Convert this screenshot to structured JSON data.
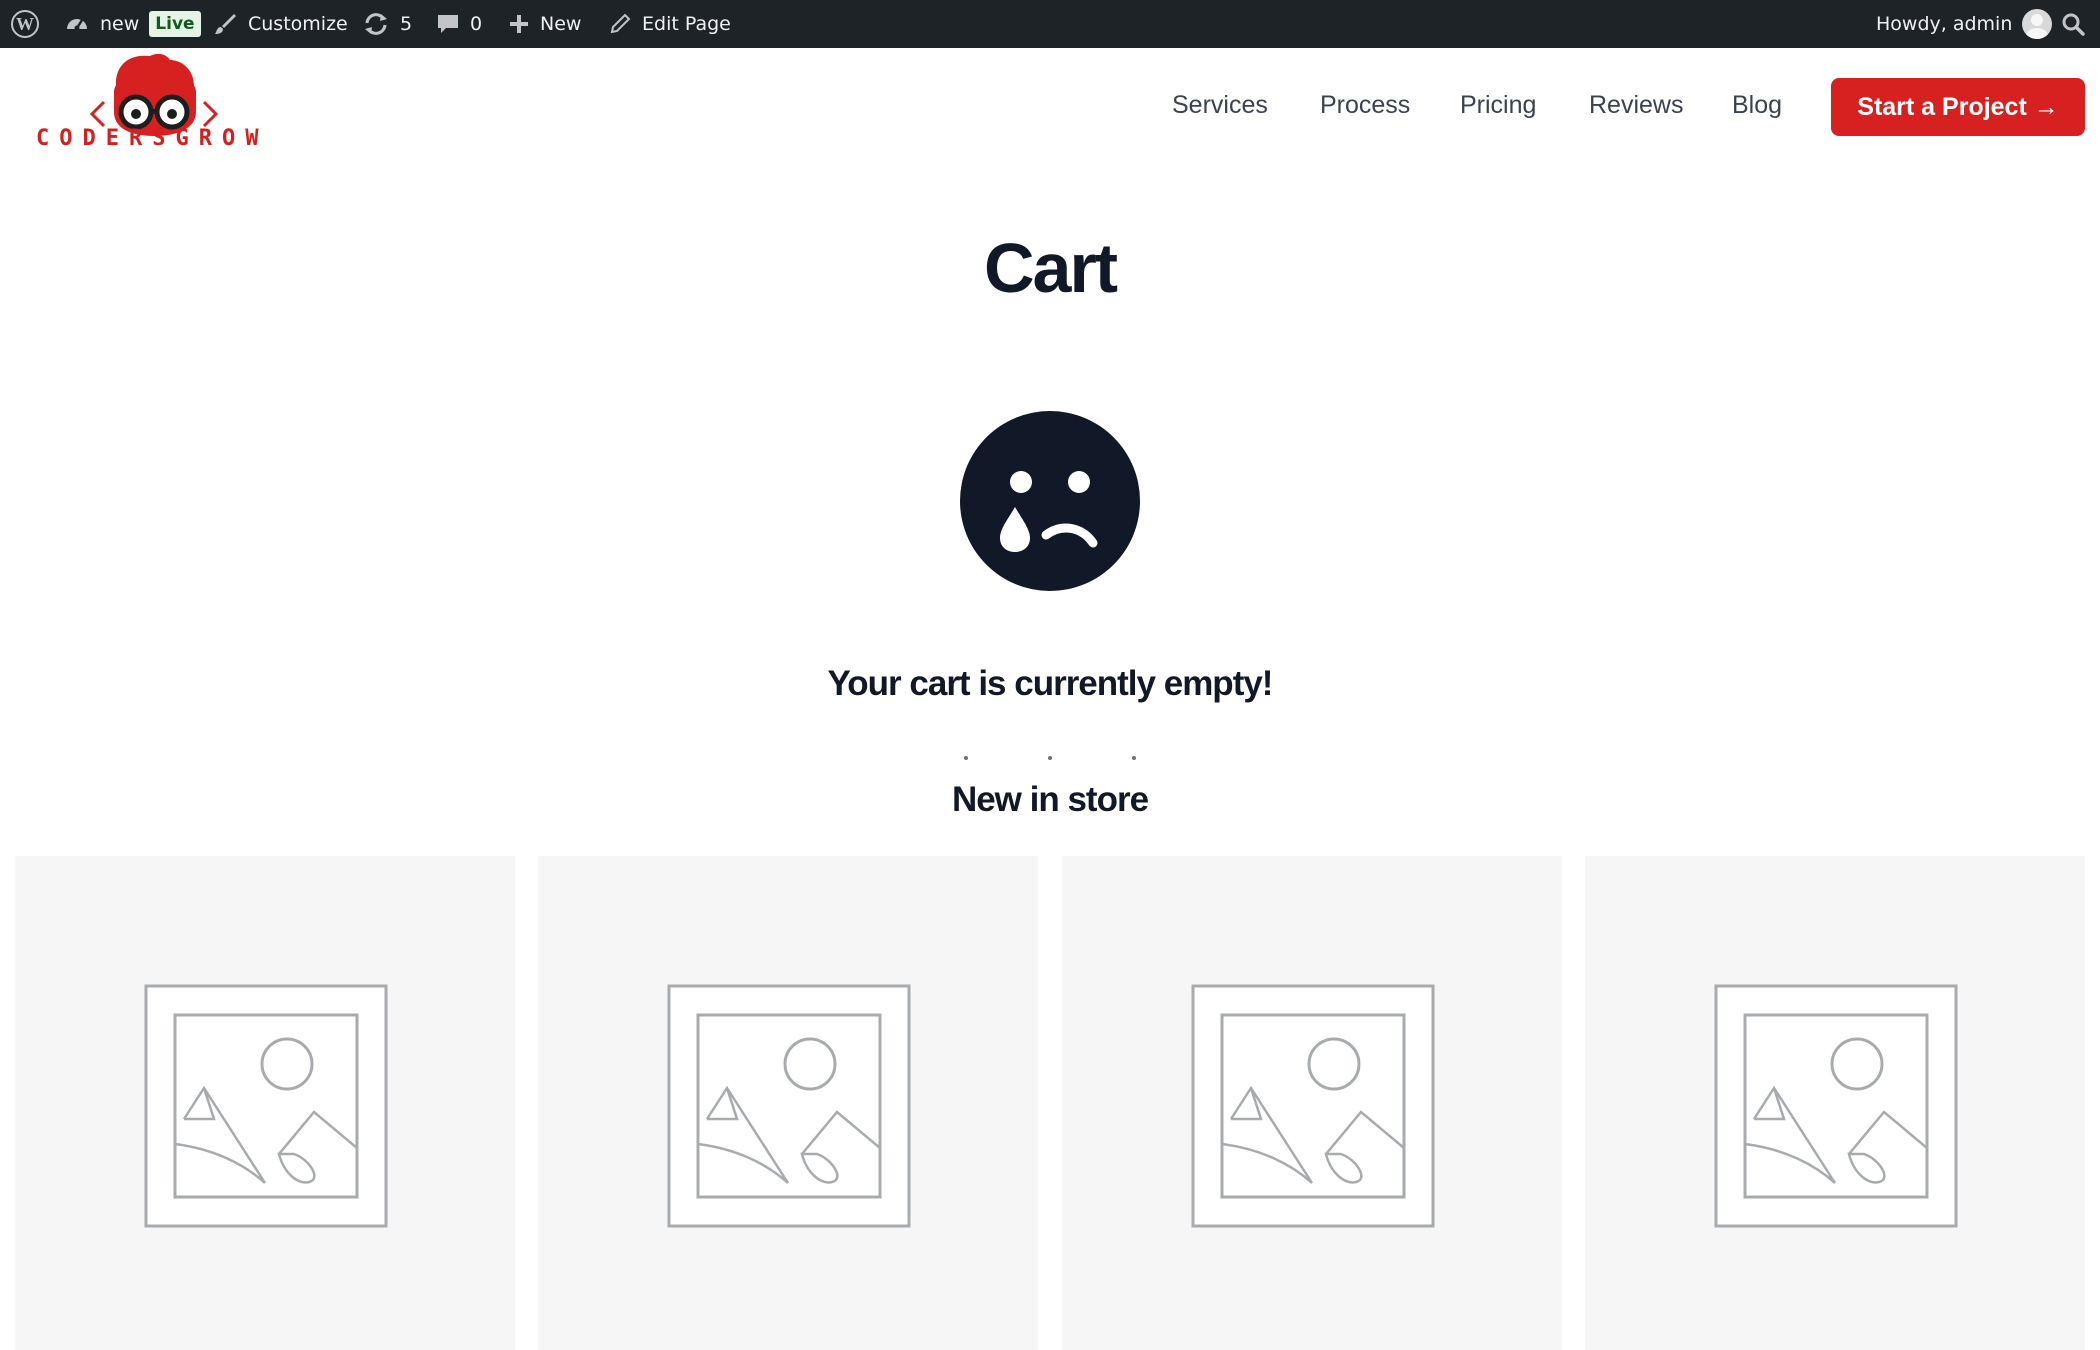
{
  "admin_bar": {
    "site_name": "new",
    "live_badge": "Live",
    "customize": "Customize",
    "updates_count": "5",
    "comments_count": "0",
    "new_label": "New",
    "edit_page": "Edit Page",
    "greeting": "Howdy, admin"
  },
  "header": {
    "logo_text": "CODERSGROW",
    "nav": [
      "Services",
      "Process",
      "Pricing",
      "Reviews",
      "Blog"
    ],
    "cta_label": "Start a Project →"
  },
  "main": {
    "title": "Cart",
    "empty_message": "Your cart is currently empty!",
    "section_heading": "New in store"
  },
  "products": [
    {
      "image": "placeholder-image-icon"
    },
    {
      "image": "placeholder-image-icon"
    },
    {
      "image": "placeholder-image-icon"
    },
    {
      "image": "placeholder-image-icon"
    }
  ],
  "colors": {
    "admin_bar_bg": "#1d2327",
    "brand_red": "#d72020",
    "heading_dark": "#111827",
    "card_bg": "#f5f6f5"
  }
}
